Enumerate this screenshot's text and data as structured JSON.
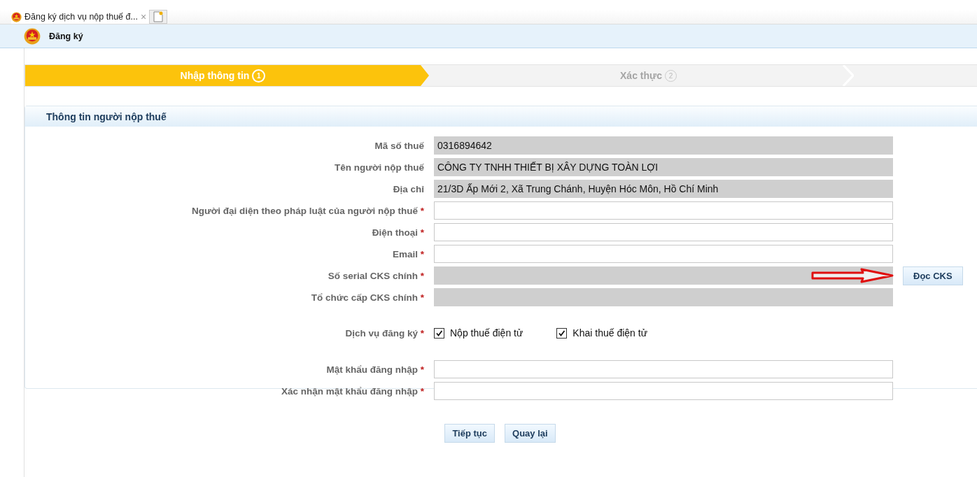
{
  "browser_tab": {
    "title": "Đăng ký dịch vụ nộp thuế đ...",
    "close": "×"
  },
  "header": {
    "title": "Đăng ký"
  },
  "steps": [
    {
      "label": "Nhập thông tin",
      "number": "1",
      "selected": true
    },
    {
      "label": "Xác thực",
      "number": "2",
      "selected": false
    }
  ],
  "panel": {
    "title": "Thông tin người nộp thuế",
    "rows": [
      {
        "kind": "readonly",
        "label": "Mã số thuế",
        "value": "0316894642"
      },
      {
        "kind": "readonly",
        "label": "Tên người nộp thuế",
        "value": "CÔNG TY TNHH THIẾT BỊ XÂY DỰNG TOÀN LỢI"
      },
      {
        "kind": "readonly",
        "label": "Địa chỉ",
        "value": "21/3D Ấp Mới 2, Xã Trung Chánh, Huyện Hóc Môn, Hồ Chí Minh"
      },
      {
        "kind": "input",
        "label": "Người đại diện theo pháp luật của người nộp thuế",
        "required_mark": "*"
      },
      {
        "kind": "input",
        "label": "Điện thoại",
        "required_mark": "*"
      },
      {
        "kind": "input",
        "label": "Email",
        "required_mark": "*"
      },
      {
        "kind": "readonly",
        "label": "Số serial CKS chính",
        "required_mark": "*",
        "button": "Đọc CKS"
      },
      {
        "kind": "readonly",
        "label": "Tổ chức cấp CKS chính",
        "required_mark": "*"
      },
      {
        "kind": "checkboxes",
        "label": "Dịch vụ đăng ký",
        "required_mark": "*",
        "options": [
          {
            "label": "Nộp thuế điện tử",
            "checked": true
          },
          {
            "label": "Khai thuế điện tử",
            "checked": true
          }
        ]
      },
      {
        "kind": "input",
        "label": "Mật khẩu đăng nhập",
        "required_mark": "*"
      },
      {
        "kind": "input",
        "label": "Xác nhận mật khẩu đăng nhập",
        "required_mark": "*"
      }
    ]
  },
  "buttons": [
    "Tiếp tục",
    "Quay lại"
  ]
}
